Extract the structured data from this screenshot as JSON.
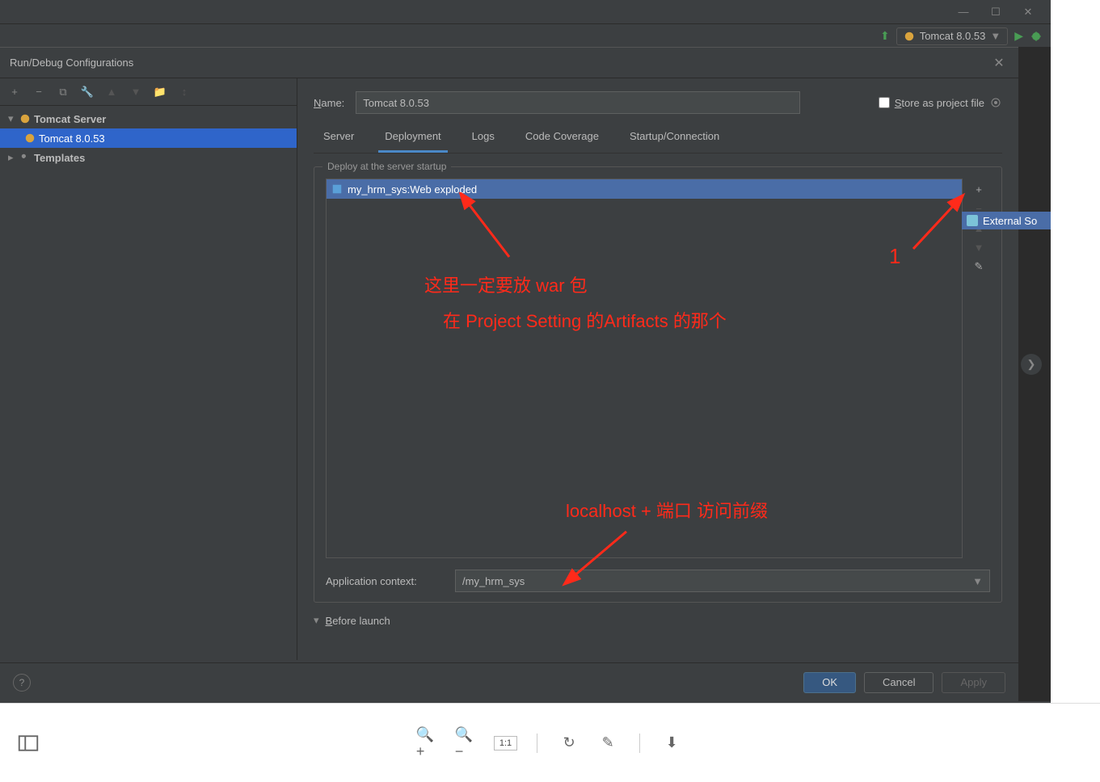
{
  "dialog": {
    "title": "Run/Debug Configurations",
    "name_label": "Name:",
    "name_value": "Tomcat 8.0.53",
    "store_label": "Store as project file"
  },
  "toolbar": {
    "run_config_dropdown": "Tomcat 8.0.53"
  },
  "tree": {
    "items": [
      {
        "label": "Tomcat Server",
        "expanded": true
      },
      {
        "label": "Tomcat 8.0.53",
        "selected": true
      }
    ],
    "templates_label": "Templates"
  },
  "tabs": [
    "Server",
    "Deployment",
    "Logs",
    "Code Coverage",
    "Startup/Connection"
  ],
  "active_tab": 1,
  "deploy": {
    "legend": "Deploy at the server startup",
    "items": [
      "my_hrm_sys:Web exploded"
    ]
  },
  "context": {
    "label": "Application context:",
    "value": "/my_hrm_sys"
  },
  "before_launch": "Before launch",
  "buttons": {
    "ok": "OK",
    "cancel": "Cancel",
    "apply": "Apply"
  },
  "popup": {
    "external_source": "External So"
  },
  "viewer": {
    "page": "1:1"
  },
  "annotations": {
    "t1": "这里一定要放 war 包",
    "t2": "在 Project Setting 的Artifacts 的那个",
    "t3": "localhost + 端口 访问前缀",
    "n1": "1"
  }
}
